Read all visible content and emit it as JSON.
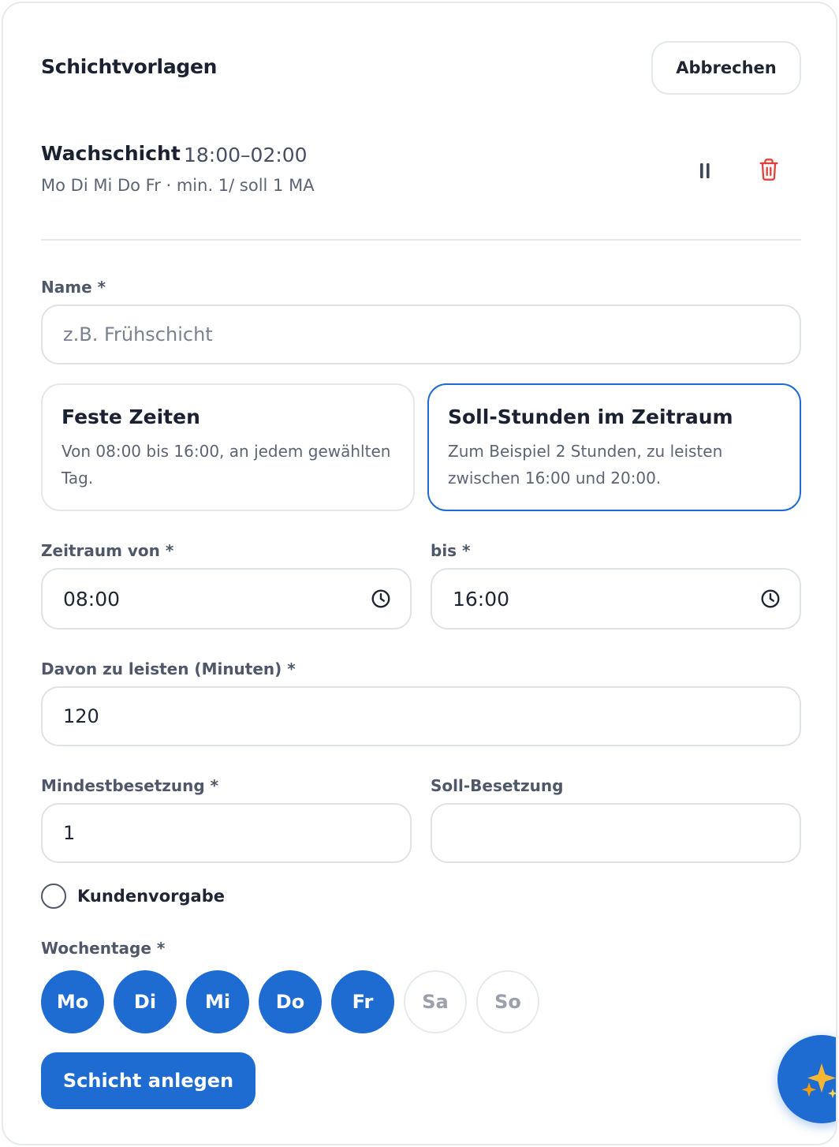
{
  "header": {
    "title": "Schichtvorlagen",
    "cancel_label": "Abbrechen"
  },
  "template": {
    "name": "Wachschicht",
    "time": "18:00–02:00",
    "summary": "Mo Di Mi Do Fr · min. 1/ soll 1 MA",
    "pause_icon": "pause-icon",
    "delete_icon": "trash-icon"
  },
  "form": {
    "name_label": "Name *",
    "name_placeholder": "z.B. Frühschicht",
    "name_value": "",
    "modes": [
      {
        "title": "Feste Zeiten",
        "description": "Von 08:00 bis 16:00, an jedem gewählten Tag.",
        "selected": false
      },
      {
        "title": "Soll-Stunden im Zeitraum",
        "description": "Zum Beispiel 2 Stunden, zu leisten zwischen 16:00 und 20:00.",
        "selected": true
      }
    ],
    "from_label": "Zeitraum von *",
    "from_value": "08:00",
    "to_label": "bis *",
    "to_value": "16:00",
    "minutes_label": "Davon zu leisten (Minuten) *",
    "minutes_value": "120",
    "min_staff_label": "Mindestbesetzung *",
    "min_staff_value": "1",
    "target_staff_label": "Soll-Besetzung",
    "target_staff_value": "",
    "customer_label": "Kundenvorgabe",
    "customer_checked": false,
    "weekdays_label": "Wochentage *",
    "weekdays": [
      {
        "label": "Mo",
        "active": true
      },
      {
        "label": "Di",
        "active": true
      },
      {
        "label": "Mi",
        "active": true
      },
      {
        "label": "Do",
        "active": true
      },
      {
        "label": "Fr",
        "active": true
      },
      {
        "label": "Sa",
        "active": false
      },
      {
        "label": "So",
        "active": false
      }
    ],
    "submit_label": "Schicht anlegen"
  },
  "fab": {
    "icon": "sparkles-icon"
  },
  "colors": {
    "accent": "#1e6bd1",
    "danger": "#e0413b",
    "sparkle": "#f5a524"
  }
}
